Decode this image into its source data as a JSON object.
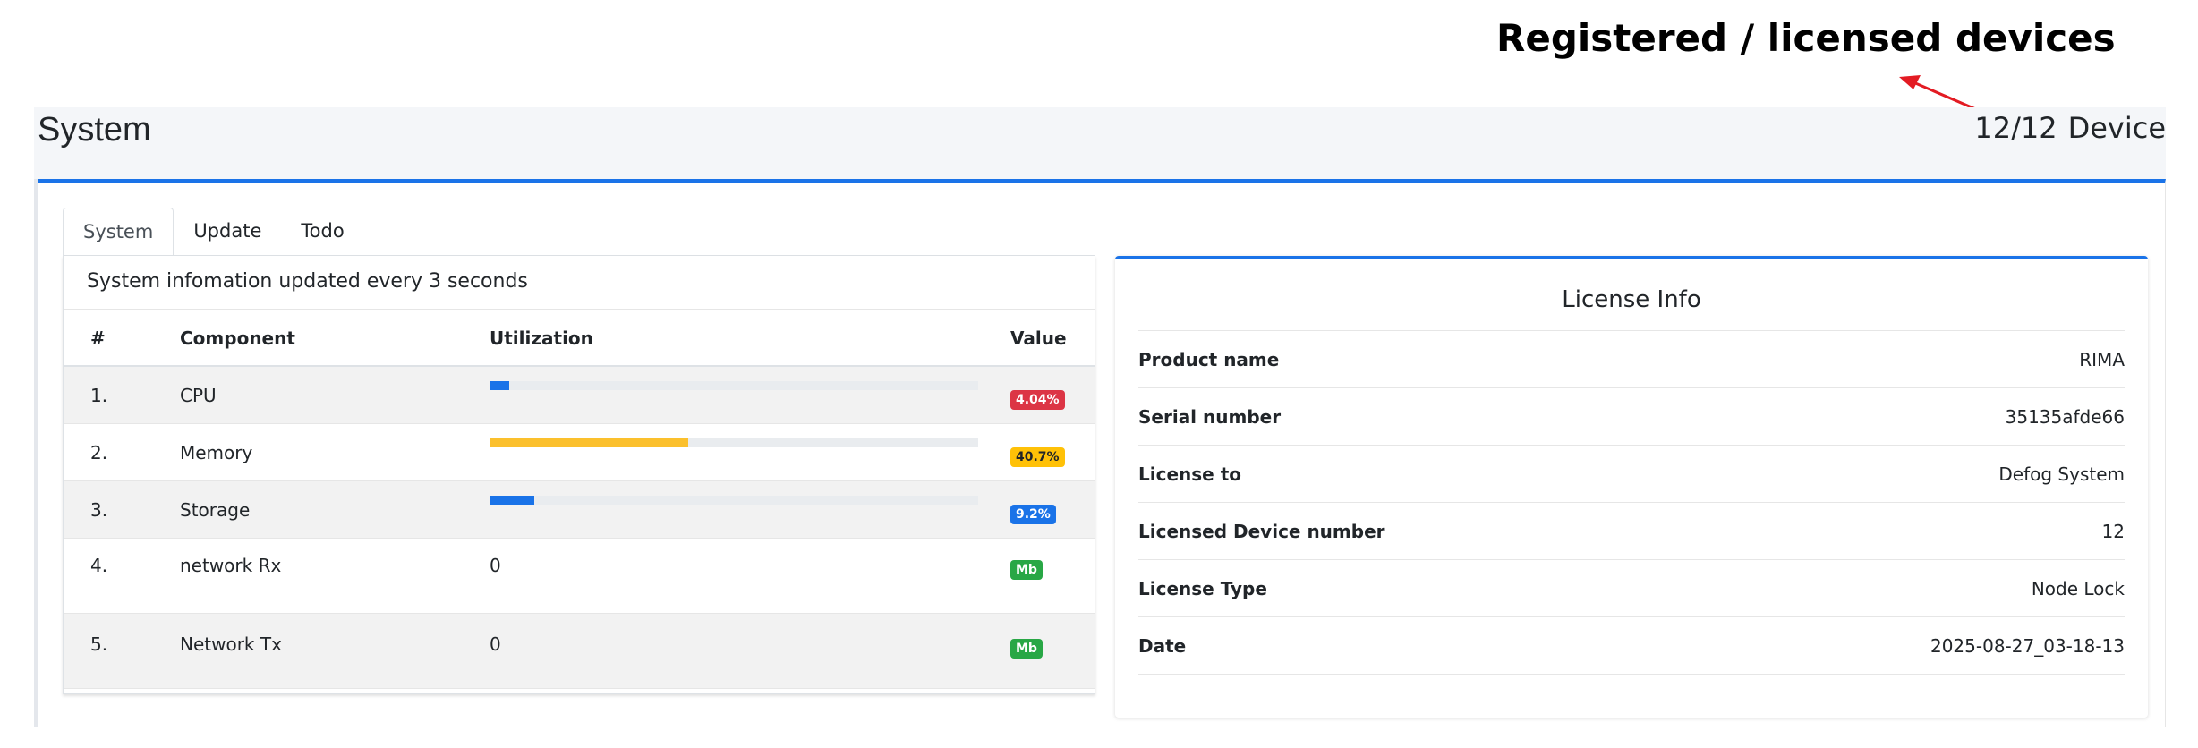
{
  "annotation": {
    "title": "Registered / licensed devices",
    "arrow_color": "#e31b23"
  },
  "header": {
    "title": "System",
    "device_count": "12/12",
    "device_label": "Device"
  },
  "tabs": [
    {
      "label": "System",
      "active": true
    },
    {
      "label": "Update",
      "active": false
    },
    {
      "label": "Todo",
      "active": false
    }
  ],
  "system": {
    "header": "System infomation updated every 3 seconds",
    "columns": [
      "#",
      "Component",
      "Utilization",
      "Value"
    ],
    "rows": [
      {
        "num": "1.",
        "component": "CPU",
        "utilization_pct": 4.04,
        "bar_color": "#1a73e8",
        "value": "4.04%",
        "badge_color": "#dc3545",
        "badge_text_color": "#ffffff"
      },
      {
        "num": "2.",
        "component": "Memory",
        "utilization_pct": 40.7,
        "bar_color": "#fbc02d",
        "value": "40.7%",
        "badge_color": "#ffc107",
        "badge_text_color": "#212529"
      },
      {
        "num": "3.",
        "component": "Storage",
        "utilization_pct": 9.2,
        "bar_color": "#1a73e8",
        "value": "9.2%",
        "badge_color": "#1a73e8",
        "badge_text_color": "#ffffff"
      },
      {
        "num": "4.",
        "component": "network Rx",
        "utilization_text": "0",
        "value": "Mb",
        "badge_color": "#28a745",
        "badge_text_color": "#ffffff"
      },
      {
        "num": "5.",
        "component": "Network Tx",
        "utilization_text": "0",
        "value": "Mb",
        "badge_color": "#28a745",
        "badge_text_color": "#ffffff"
      }
    ]
  },
  "license": {
    "title": "License Info",
    "rows": [
      {
        "label": "Product name",
        "value": "RIMA"
      },
      {
        "label": "Serial number",
        "value": "35135afde66"
      },
      {
        "label": "License to",
        "value": "Defog System"
      },
      {
        "label": "Licensed Device number",
        "value": "12"
      },
      {
        "label": "License Type",
        "value": "Node Lock"
      },
      {
        "label": "Date",
        "value": "2025-08-27_03-18-13"
      }
    ]
  },
  "colors": {
    "accent": "#1a73e8",
    "page_bg": "#f4f6f9"
  }
}
